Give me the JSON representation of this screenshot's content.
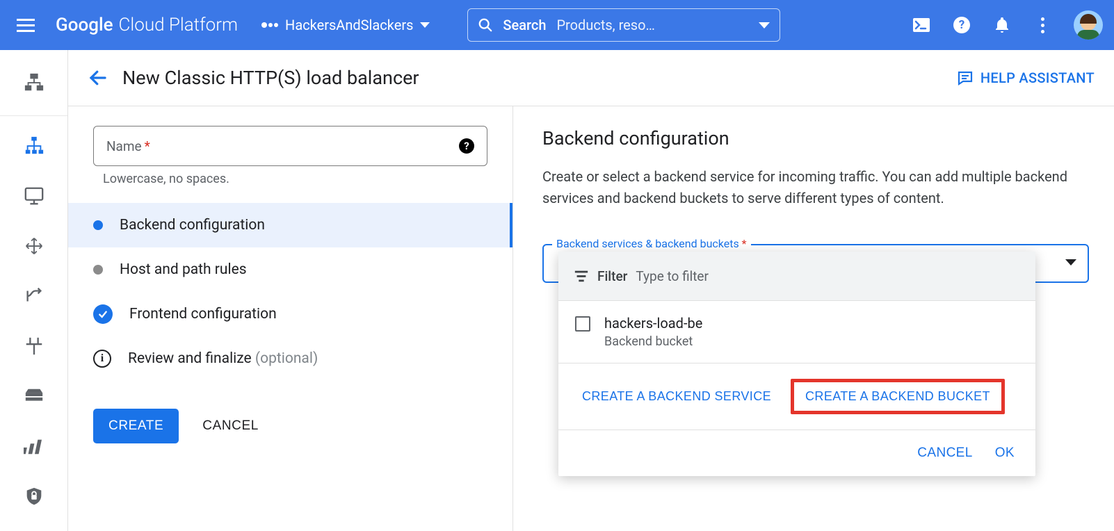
{
  "header": {
    "brand_google": "Google",
    "brand_cp": "Cloud Platform",
    "project": "HackersAndSlackers",
    "search_label": "Search",
    "search_placeholder": "Products, reso…"
  },
  "page": {
    "title": "New Classic HTTP(S) load balancer",
    "help_assistant": "HELP ASSISTANT"
  },
  "form": {
    "name_label": "Name",
    "name_hint": "Lowercase, no spaces."
  },
  "steps": {
    "backend": "Backend configuration",
    "hostpath": "Host and path rules",
    "frontend": "Frontend configuration",
    "review": "Review and finalize",
    "optional": "(optional)"
  },
  "actions": {
    "create": "CREATE",
    "cancel": "CANCEL"
  },
  "right": {
    "title": "Backend configuration",
    "desc": "Create or select a backend service for incoming traffic. You can add multiple backend services and backend buckets to serve different types of content.",
    "select_label": "Backend services & backend buckets"
  },
  "popover": {
    "filter_label": "Filter",
    "filter_placeholder": "Type to filter",
    "option_name": "hackers-load-be",
    "option_type": "Backend bucket",
    "create_service": "CREATE A BACKEND SERVICE",
    "create_bucket": "CREATE A BACKEND BUCKET",
    "cancel": "CANCEL",
    "ok": "OK"
  }
}
